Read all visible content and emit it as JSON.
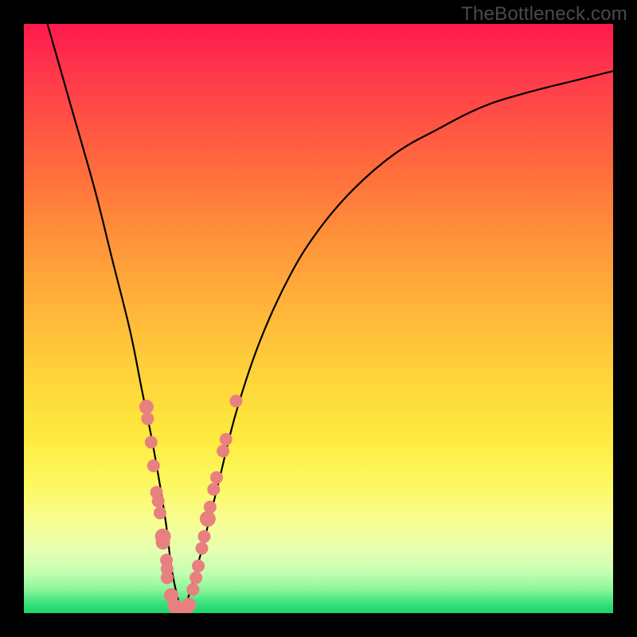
{
  "watermark": "TheBottleneck.com",
  "chart_data": {
    "type": "line",
    "title": "",
    "xlabel": "",
    "ylabel": "",
    "xlim": [
      0,
      100
    ],
    "ylim": [
      0,
      100
    ],
    "grid": false,
    "legend": false,
    "background_gradient": [
      "#ff1a4d",
      "#ff913a",
      "#feea3f",
      "#1bd46b"
    ],
    "series": [
      {
        "name": "bottleneck-curve",
        "color": "#000000",
        "x": [
          4,
          8,
          12,
          15,
          18,
          20,
          22,
          24,
          25,
          26,
          27,
          28,
          30,
          33,
          36,
          40,
          45,
          50,
          56,
          63,
          70,
          78,
          86,
          94,
          100
        ],
        "y": [
          100,
          86,
          72,
          60,
          48,
          38,
          28,
          16,
          8,
          3,
          0,
          3,
          10,
          22,
          34,
          46,
          57,
          65,
          72,
          78,
          82,
          86,
          88.5,
          90.5,
          92
        ]
      }
    ],
    "points": [
      {
        "name": "dots-left-branch",
        "color": "#e98080",
        "x": [
          20.8,
          21.0,
          21.6,
          22.0,
          22.5,
          22.8,
          23.1,
          23.6,
          23.6,
          24.2,
          24.3,
          24.3,
          25.0
        ],
        "y": [
          35,
          33,
          29,
          25,
          20.5,
          19,
          17,
          13,
          12,
          9,
          7.5,
          6,
          3
        ],
        "size": [
          9,
          8,
          8,
          8,
          8,
          8,
          8,
          10,
          9,
          8,
          8,
          8,
          9
        ]
      },
      {
        "name": "dots-valley",
        "color": "#e98080",
        "x": [
          25.6,
          26.0,
          26.4,
          27.0,
          27.5,
          28.0
        ],
        "y": [
          1.2,
          0.9,
          0.8,
          0.8,
          0.9,
          1.4
        ],
        "size": [
          9,
          9,
          9,
          9,
          9,
          9
        ]
      },
      {
        "name": "dots-right-branch",
        "color": "#e98080",
        "x": [
          28.7,
          29.2,
          29.6,
          30.2,
          30.6,
          31.2,
          31.6,
          32.2,
          32.7,
          33.8,
          34.3,
          36.0
        ],
        "y": [
          4,
          6,
          8,
          11,
          13,
          16,
          18,
          21,
          23,
          27.5,
          29.5,
          36
        ],
        "size": [
          8,
          8,
          8,
          8,
          8,
          10,
          8,
          8,
          8,
          8,
          8,
          8
        ]
      }
    ]
  }
}
